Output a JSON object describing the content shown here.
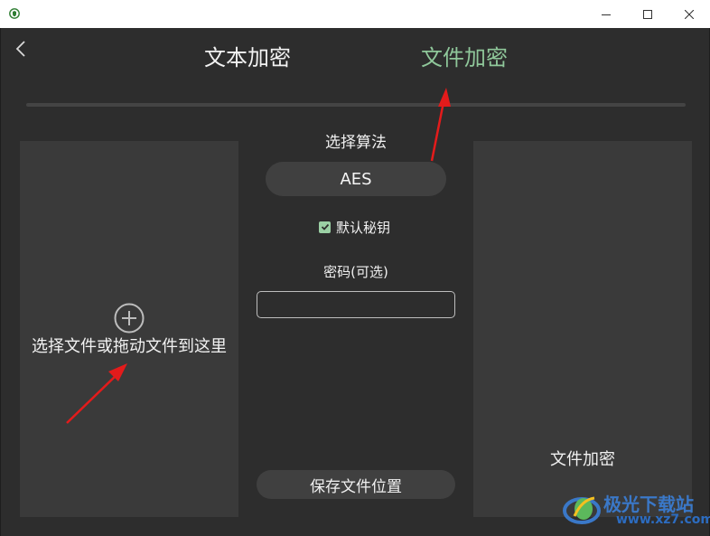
{
  "window": {
    "icon": "app-shield-icon",
    "controls": [
      "minimize-icon",
      "maximize-icon",
      "close-icon"
    ]
  },
  "nav": {
    "back_icon": "chevron-left-icon",
    "tabs": [
      {
        "label": "文本加密",
        "active": false
      },
      {
        "label": "文件加密",
        "active": true
      }
    ]
  },
  "drop_zone": {
    "icon": "plus-circle-icon",
    "label": "选择文件或拖动文件到这里"
  },
  "settings": {
    "algorithm_title": "选择算法",
    "algorithm_value": "AES",
    "default_key_checked": true,
    "default_key_label": "默认秘钥",
    "password_title": "密码(可选)",
    "password_value": "",
    "save_location_label": "保存文件位置"
  },
  "encrypt_panel": {
    "label": "文件加密"
  },
  "watermark": {
    "text": "极光下载站",
    "url": "www.xz7.com"
  },
  "colors": {
    "background": "#2d2d2d",
    "panel": "#3a3a3a",
    "accent_green": "#8fc79a",
    "arrow_red": "#e31b1b"
  }
}
